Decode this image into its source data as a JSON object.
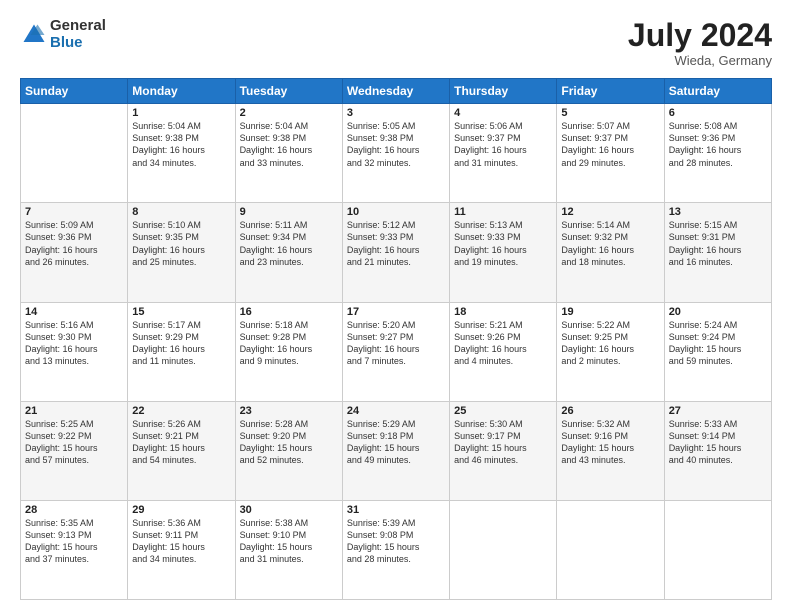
{
  "logo": {
    "general": "General",
    "blue": "Blue"
  },
  "title": "July 2024",
  "location": "Wieda, Germany",
  "days_of_week": [
    "Sunday",
    "Monday",
    "Tuesday",
    "Wednesday",
    "Thursday",
    "Friday",
    "Saturday"
  ],
  "weeks": [
    [
      {
        "day": "",
        "info": ""
      },
      {
        "day": "1",
        "info": "Sunrise: 5:04 AM\nSunset: 9:38 PM\nDaylight: 16 hours\nand 34 minutes."
      },
      {
        "day": "2",
        "info": "Sunrise: 5:04 AM\nSunset: 9:38 PM\nDaylight: 16 hours\nand 33 minutes."
      },
      {
        "day": "3",
        "info": "Sunrise: 5:05 AM\nSunset: 9:38 PM\nDaylight: 16 hours\nand 32 minutes."
      },
      {
        "day": "4",
        "info": "Sunrise: 5:06 AM\nSunset: 9:37 PM\nDaylight: 16 hours\nand 31 minutes."
      },
      {
        "day": "5",
        "info": "Sunrise: 5:07 AM\nSunset: 9:37 PM\nDaylight: 16 hours\nand 29 minutes."
      },
      {
        "day": "6",
        "info": "Sunrise: 5:08 AM\nSunset: 9:36 PM\nDaylight: 16 hours\nand 28 minutes."
      }
    ],
    [
      {
        "day": "7",
        "info": "Sunrise: 5:09 AM\nSunset: 9:36 PM\nDaylight: 16 hours\nand 26 minutes."
      },
      {
        "day": "8",
        "info": "Sunrise: 5:10 AM\nSunset: 9:35 PM\nDaylight: 16 hours\nand 25 minutes."
      },
      {
        "day": "9",
        "info": "Sunrise: 5:11 AM\nSunset: 9:34 PM\nDaylight: 16 hours\nand 23 minutes."
      },
      {
        "day": "10",
        "info": "Sunrise: 5:12 AM\nSunset: 9:33 PM\nDaylight: 16 hours\nand 21 minutes."
      },
      {
        "day": "11",
        "info": "Sunrise: 5:13 AM\nSunset: 9:33 PM\nDaylight: 16 hours\nand 19 minutes."
      },
      {
        "day": "12",
        "info": "Sunrise: 5:14 AM\nSunset: 9:32 PM\nDaylight: 16 hours\nand 18 minutes."
      },
      {
        "day": "13",
        "info": "Sunrise: 5:15 AM\nSunset: 9:31 PM\nDaylight: 16 hours\nand 16 minutes."
      }
    ],
    [
      {
        "day": "14",
        "info": "Sunrise: 5:16 AM\nSunset: 9:30 PM\nDaylight: 16 hours\nand 13 minutes."
      },
      {
        "day": "15",
        "info": "Sunrise: 5:17 AM\nSunset: 9:29 PM\nDaylight: 16 hours\nand 11 minutes."
      },
      {
        "day": "16",
        "info": "Sunrise: 5:18 AM\nSunset: 9:28 PM\nDaylight: 16 hours\nand 9 minutes."
      },
      {
        "day": "17",
        "info": "Sunrise: 5:20 AM\nSunset: 9:27 PM\nDaylight: 16 hours\nand 7 minutes."
      },
      {
        "day": "18",
        "info": "Sunrise: 5:21 AM\nSunset: 9:26 PM\nDaylight: 16 hours\nand 4 minutes."
      },
      {
        "day": "19",
        "info": "Sunrise: 5:22 AM\nSunset: 9:25 PM\nDaylight: 16 hours\nand 2 minutes."
      },
      {
        "day": "20",
        "info": "Sunrise: 5:24 AM\nSunset: 9:24 PM\nDaylight: 15 hours\nand 59 minutes."
      }
    ],
    [
      {
        "day": "21",
        "info": "Sunrise: 5:25 AM\nSunset: 9:22 PM\nDaylight: 15 hours\nand 57 minutes."
      },
      {
        "day": "22",
        "info": "Sunrise: 5:26 AM\nSunset: 9:21 PM\nDaylight: 15 hours\nand 54 minutes."
      },
      {
        "day": "23",
        "info": "Sunrise: 5:28 AM\nSunset: 9:20 PM\nDaylight: 15 hours\nand 52 minutes."
      },
      {
        "day": "24",
        "info": "Sunrise: 5:29 AM\nSunset: 9:18 PM\nDaylight: 15 hours\nand 49 minutes."
      },
      {
        "day": "25",
        "info": "Sunrise: 5:30 AM\nSunset: 9:17 PM\nDaylight: 15 hours\nand 46 minutes."
      },
      {
        "day": "26",
        "info": "Sunrise: 5:32 AM\nSunset: 9:16 PM\nDaylight: 15 hours\nand 43 minutes."
      },
      {
        "day": "27",
        "info": "Sunrise: 5:33 AM\nSunset: 9:14 PM\nDaylight: 15 hours\nand 40 minutes."
      }
    ],
    [
      {
        "day": "28",
        "info": "Sunrise: 5:35 AM\nSunset: 9:13 PM\nDaylight: 15 hours\nand 37 minutes."
      },
      {
        "day": "29",
        "info": "Sunrise: 5:36 AM\nSunset: 9:11 PM\nDaylight: 15 hours\nand 34 minutes."
      },
      {
        "day": "30",
        "info": "Sunrise: 5:38 AM\nSunset: 9:10 PM\nDaylight: 15 hours\nand 31 minutes."
      },
      {
        "day": "31",
        "info": "Sunrise: 5:39 AM\nSunset: 9:08 PM\nDaylight: 15 hours\nand 28 minutes."
      },
      {
        "day": "",
        "info": ""
      },
      {
        "day": "",
        "info": ""
      },
      {
        "day": "",
        "info": ""
      }
    ]
  ]
}
